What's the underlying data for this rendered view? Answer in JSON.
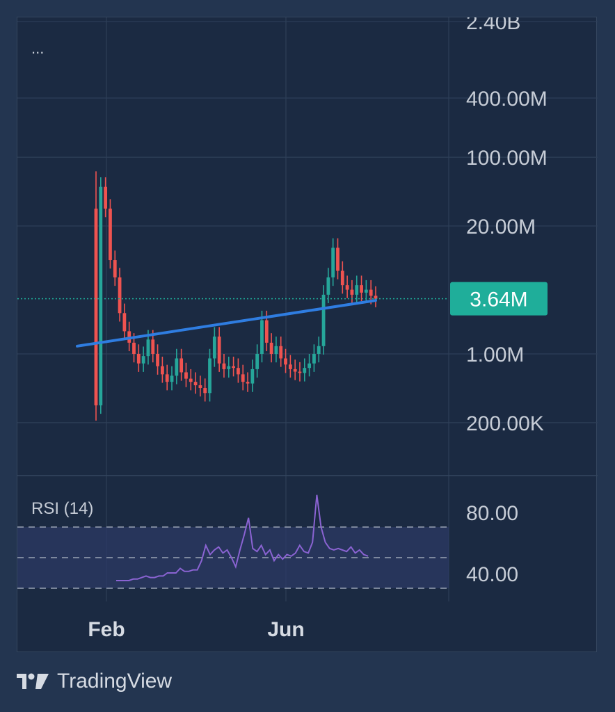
{
  "menu_dots": "...",
  "price_axis": {
    "ticks": [
      "2.40B",
      "400.00M",
      "100.00M",
      "20.00M",
      "1.00M",
      "200.00K"
    ]
  },
  "current_price": {
    "label": "3.64M",
    "value": 3640000,
    "color": "#1fae9a"
  },
  "time_axis": {
    "ticks": [
      "Feb",
      "Jun"
    ]
  },
  "rsi": {
    "title": "RSI (14)",
    "ticks": [
      "80.00",
      "40.00"
    ],
    "bands": {
      "upper": 70,
      "middle": 50,
      "lower": 30
    },
    "color": "#8a63d2"
  },
  "colors": {
    "up": "#26a69a",
    "down": "#ef5350",
    "trendline": "#2f7de1",
    "background": "#1b2a42"
  },
  "brand": {
    "name": "TradingView"
  },
  "chart_data": [
    {
      "type": "candlestick",
      "scale": "log",
      "y_range": [
        100000,
        2400000000
      ],
      "x_ticks": [
        "Feb",
        "Jun"
      ],
      "current_value": 3640000,
      "series": [
        {
          "name": "",
          "close": [
            300000,
            50000000,
            30000000,
            9000000,
            6000000,
            2600000,
            1700000,
            1300000,
            1000000,
            800000,
            950000,
            1400000,
            1000000,
            750000,
            620000,
            520000,
            600000,
            900000,
            650000,
            560000,
            520000,
            480000,
            450000,
            400000,
            900000,
            1500000,
            800000,
            700000,
            750000,
            720000,
            620000,
            520000,
            500000,
            700000,
            1000000,
            2200000,
            1300000,
            1000000,
            1200000,
            900000,
            780000,
            700000,
            660000,
            640000,
            720000,
            800000,
            1000000,
            1200000,
            4000000,
            6000000,
            12000000,
            7000000,
            5000000,
            4500000,
            4000000,
            5000000,
            4200000,
            4500000,
            3900000,
            3640000
          ]
        },
        {
          "name": "trendline",
          "start": 1200000,
          "end": 3500000
        }
      ]
    },
    {
      "type": "line",
      "name": "RSI (14)",
      "y_range": [
        30,
        100
      ],
      "x_ticks": [
        "Feb",
        "Jun"
      ],
      "bands": [
        70,
        50,
        30
      ],
      "series": [
        {
          "name": "",
          "values": [
            35,
            35,
            35,
            35,
            36,
            36,
            37,
            38,
            37,
            37,
            38,
            38,
            40,
            40,
            40,
            43,
            41,
            41,
            42,
            42,
            48,
            58,
            52,
            55,
            57,
            53,
            55,
            50,
            44,
            55,
            65,
            76,
            56,
            54,
            58,
            52,
            55,
            48,
            52,
            49,
            52,
            51,
            53,
            58,
            54,
            53,
            60,
            91,
            70,
            60,
            56,
            55,
            56,
            55,
            54,
            57,
            53,
            55,
            52,
            51
          ]
        }
      ]
    }
  ]
}
